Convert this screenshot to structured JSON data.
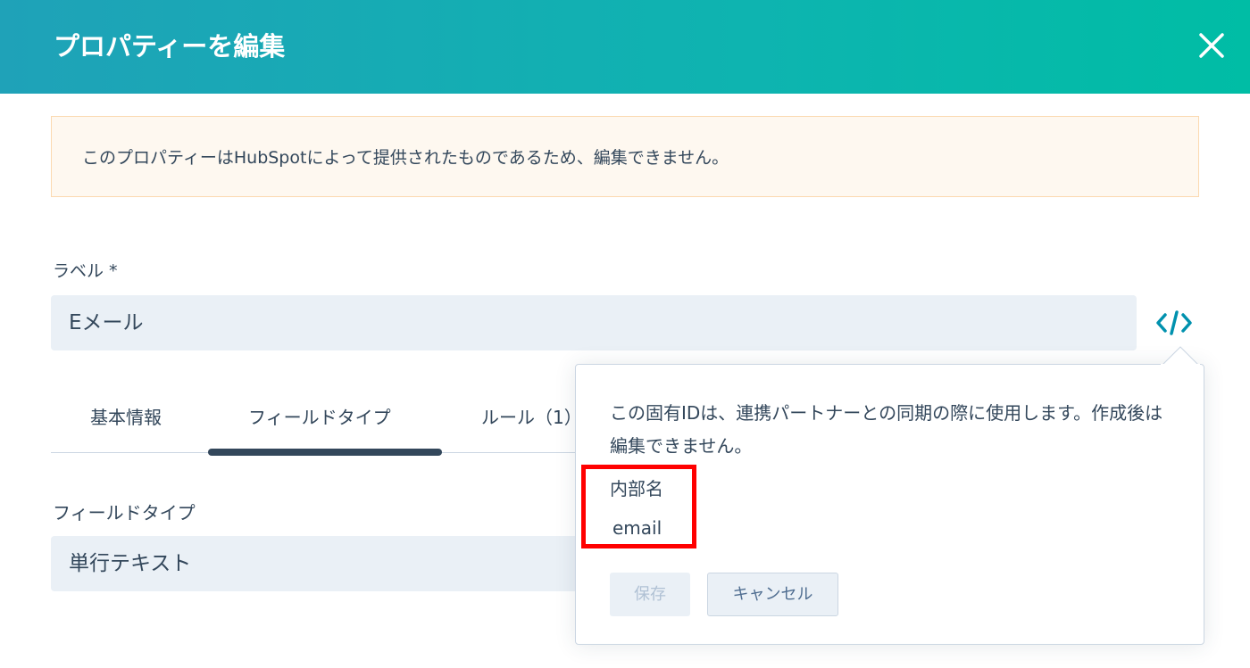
{
  "header": {
    "title": "プロパティーを編集",
    "close_icon": "close-icon"
  },
  "notice": {
    "text": "このプロパティーはHubSpotによって提供されたものであるため、編集できません。"
  },
  "label_field": {
    "label": "ラベル *",
    "value": "Eメール",
    "code_icon": "code-brackets-icon"
  },
  "tabs": [
    {
      "label": "基本情報",
      "active": false
    },
    {
      "label": "フィールドタイプ",
      "active": true
    },
    {
      "label": "ルール（1）",
      "active": false
    }
  ],
  "field_type": {
    "label": "フィールドタイプ",
    "value": "単行テキスト"
  },
  "popover": {
    "description": "この固有IDは、連携パートナーとの同期の際に使用します。作成後は編集できません。",
    "internal_name_label": "内部名",
    "internal_name_value": "email",
    "save_label": "保存",
    "cancel_label": "キャンセル"
  },
  "colors": {
    "header_start": "#1fa2b8",
    "header_end": "#00bda5",
    "notice_bg": "#fef8f0",
    "notice_border": "#fbd9b0",
    "input_bg": "#eaf0f6",
    "text": "#33475b",
    "accent_teal": "#0091ae",
    "highlight": "#ff0000"
  }
}
